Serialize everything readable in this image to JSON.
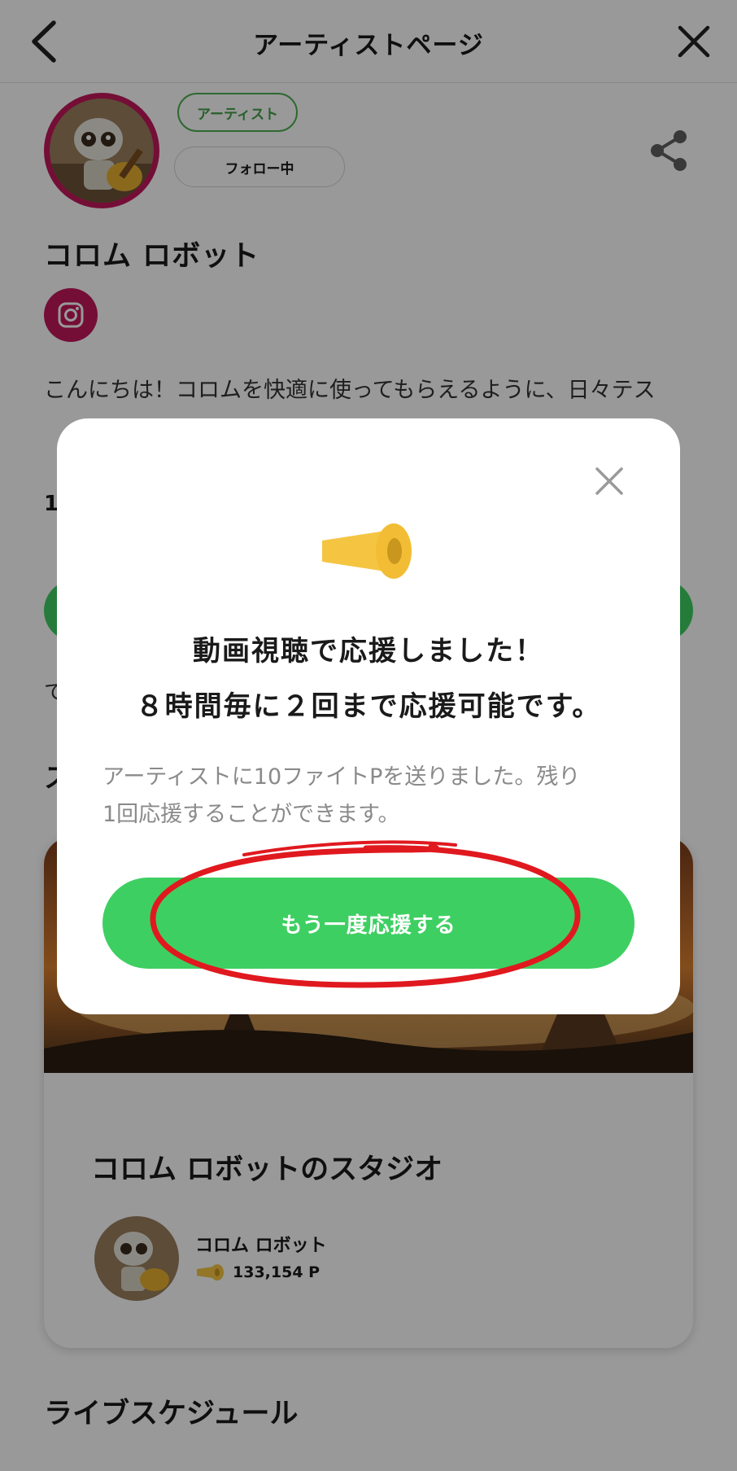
{
  "header": {
    "title": "アーティストページ",
    "back_icon": "chevron-left-icon",
    "close_icon": "close-icon"
  },
  "profile": {
    "tag": "アーティスト",
    "follow_label": "フォロー中",
    "name": "コロム ロボット",
    "instagram_icon": "instagram-icon",
    "share_icon": "share-icon",
    "bio": "こんにちは！コロムを快適に使ってもらえるように、日々テス",
    "stat_peek": "1",
    "text_peek": "で",
    "heading_peek": "ス"
  },
  "studio": {
    "title": "コロム ロボットのスタジオ",
    "artist": "コロム ロボット",
    "points": "133,154 P"
  },
  "schedule": {
    "title": "ライブスケジュール"
  },
  "modal": {
    "title_line1": "動画視聴で応援しました！",
    "title_line2": "８時間毎に２回まで応援可能です。",
    "desc_line1": "アーティストに10ファイトPを送りました。残り",
    "desc_line2": "1回応援することができます。",
    "cheer_again": "もう一度応援する",
    "close_icon": "close-icon",
    "megaphone_icon": "megaphone-icon"
  },
  "colors": {
    "accent_green": "#3ecf62",
    "tag_green": "#43a047",
    "instagram_pink": "#c2185b",
    "megaphone_yellow": "#f5c542",
    "annotation_red": "#e0191f"
  }
}
